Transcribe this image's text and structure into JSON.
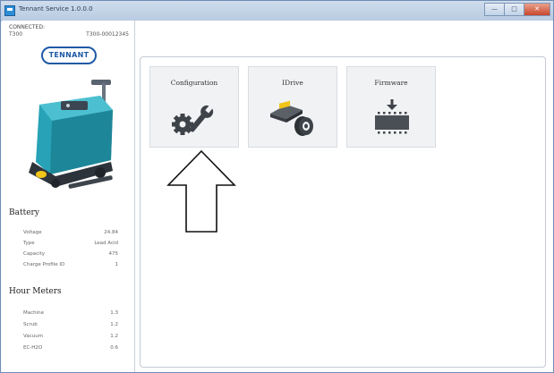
{
  "window": {
    "title": "Tennant Service 1.0.0.0",
    "controls": {
      "minimize": "—",
      "maximize": "□",
      "close": "✕"
    }
  },
  "connection": {
    "label": "CONNECTED:",
    "model": "T300",
    "serial": "T300-00012345"
  },
  "logo": {
    "text": "TENNANT"
  },
  "battery": {
    "heading": "Battery",
    "rows": [
      {
        "label": "Voltage",
        "value": "24.84"
      },
      {
        "label": "Type",
        "value": "Lead Acid"
      },
      {
        "label": "Capacity",
        "value": "475"
      },
      {
        "label": "Charge Profile ID",
        "value": "1"
      }
    ]
  },
  "hour_meters": {
    "heading": "Hour Meters",
    "rows": [
      {
        "label": "Machine",
        "value": "1.3"
      },
      {
        "label": "Scrub",
        "value": "1.2"
      },
      {
        "label": "Vacuum",
        "value": "1.2"
      },
      {
        "label": "EC-H2O",
        "value": "0.6"
      }
    ]
  },
  "tiles": [
    {
      "label": "Configuration",
      "icon": "gear-wrench-icon"
    },
    {
      "label": "IDrive",
      "icon": "idrive-icon"
    },
    {
      "label": "Firmware",
      "icon": "firmware-icon"
    }
  ],
  "colors": {
    "brand": "#1f5aa6",
    "accent": "#2aa3b8"
  }
}
